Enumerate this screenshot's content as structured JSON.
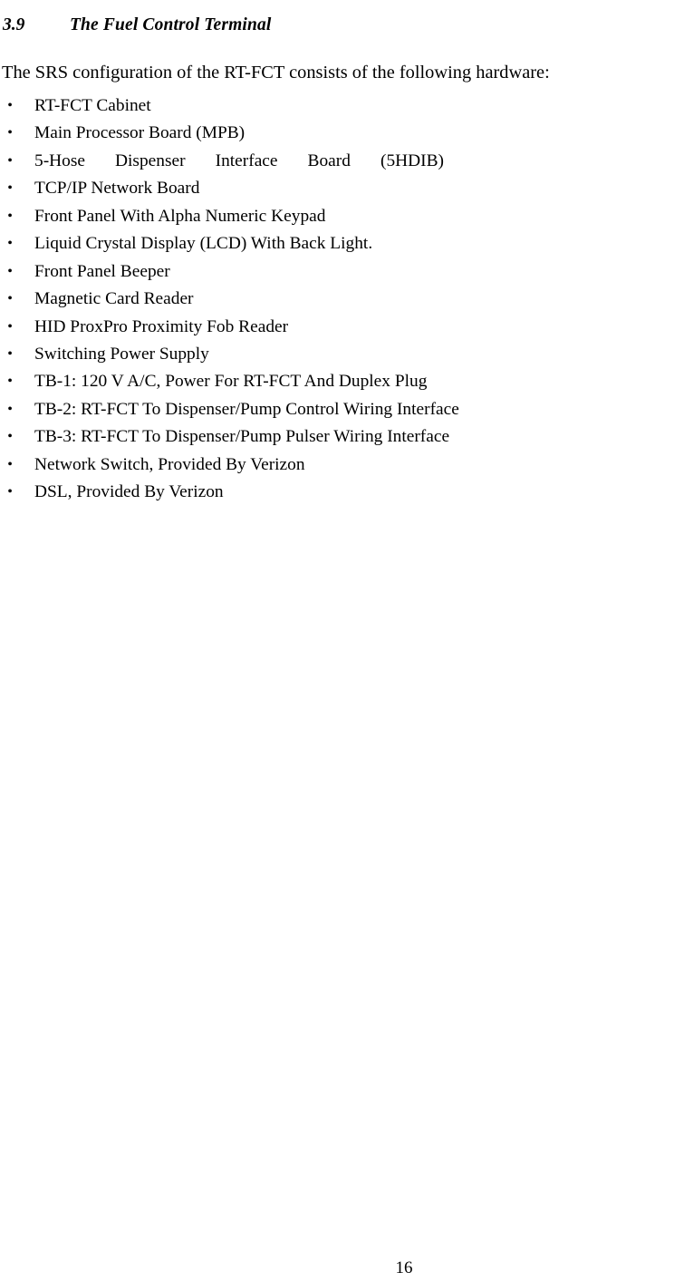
{
  "document": {
    "section": {
      "number": "3.9",
      "title": "The Fuel Control Terminal"
    },
    "intro_paragraph": "The SRS configuration of the RT-FCT consists of the following hardware:",
    "bullet_marker": "•",
    "hardware_list": [
      {
        "text": "RT-FCT Cabinet",
        "justified": false
      },
      {
        "text": "Main Processor Board (MPB)",
        "justified": false
      },
      {
        "text": "5-Hose Dispenser Interface Board (5HDIB)",
        "justified": true
      },
      {
        "text": "TCP/IP Network Board",
        "justified": false
      },
      {
        "text": "Front Panel With Alpha Numeric Keypad",
        "justified": false
      },
      {
        "text": "Liquid Crystal Display (LCD) With Back Light.",
        "justified": false
      },
      {
        "text": "Front Panel Beeper",
        "justified": false
      },
      {
        "text": "Magnetic Card Reader",
        "justified": false
      },
      {
        "text": "HID ProxPro Proximity Fob Reader",
        "justified": false
      },
      {
        "text": "Switching Power Supply",
        "justified": false
      },
      {
        "text": "TB-1: 120 V A/C, Power For RT-FCT And Duplex Plug",
        "justified": false
      },
      {
        "text": "TB-2: RT-FCT To Dispenser/Pump Control Wiring Interface",
        "justified": false
      },
      {
        "text": "TB-3: RT-FCT To Dispenser/Pump Pulser Wiring Interface",
        "justified": false
      },
      {
        "text": "Network Switch, Provided By Verizon",
        "justified": false
      },
      {
        "text": "DSL, Provided By Verizon",
        "justified": false
      }
    ],
    "page_number": "16"
  }
}
